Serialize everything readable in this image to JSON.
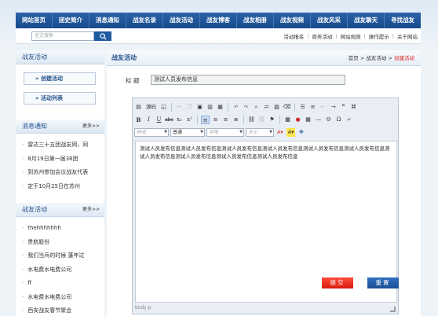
{
  "nav": [
    "网站首页",
    "团史简介",
    "消息通知",
    "战友名录",
    "战友活动",
    "战友博客",
    "战友相册",
    "战友视频",
    "战友风采",
    "战友聊天",
    "寻找战友"
  ],
  "search": {
    "placeholder": "全文搜索"
  },
  "quick_links": [
    "活动报名",
    "商务活动",
    "网站规则",
    "操作提示",
    "关于网站"
  ],
  "sidebar": {
    "activity_box": {
      "title": "战友活动",
      "buttons": [
        "创建活动",
        "活动列表"
      ]
    },
    "news_box": {
      "title": "消息通知",
      "more": "更多>>",
      "items": [
        "雷达三十五团战友网，同",
        "8月19日第一届38团",
        "到苏州参加会议战友代表",
        "定于10月25日在苏州"
      ]
    },
    "activity_list_box": {
      "title": "战友活动",
      "more": "更多>>",
      "items": [
        "thehhhhhhh",
        "贵航股份",
        "我们当兵的时候 蓬年过",
        "水电费水电费公司",
        "ff",
        "水电费水电费公司",
        "西安战友春节聚会"
      ]
    }
  },
  "main": {
    "title": "战友活动",
    "breadcrumb": {
      "home": "首页",
      "sep": ">",
      "section": "战友活动",
      "current": "创建活动"
    },
    "title_label": "标  题",
    "title_value": "测试人员发布信息",
    "editor": {
      "source_label": "源码",
      "format_combo": "样式",
      "format_value": "普通",
      "font_combo": "字体",
      "size_combo": "大小",
      "content": "测试人员发布信息测试人员发布信息测试人员发布信息测试人员发布信息测试人员发布信息测试人员发布信息测试人员发布信息测试人员发布信息测试人员发布信息测试人员发布信息",
      "status": "body  p"
    },
    "submit_label": "提交",
    "reset_label": "重置"
  }
}
